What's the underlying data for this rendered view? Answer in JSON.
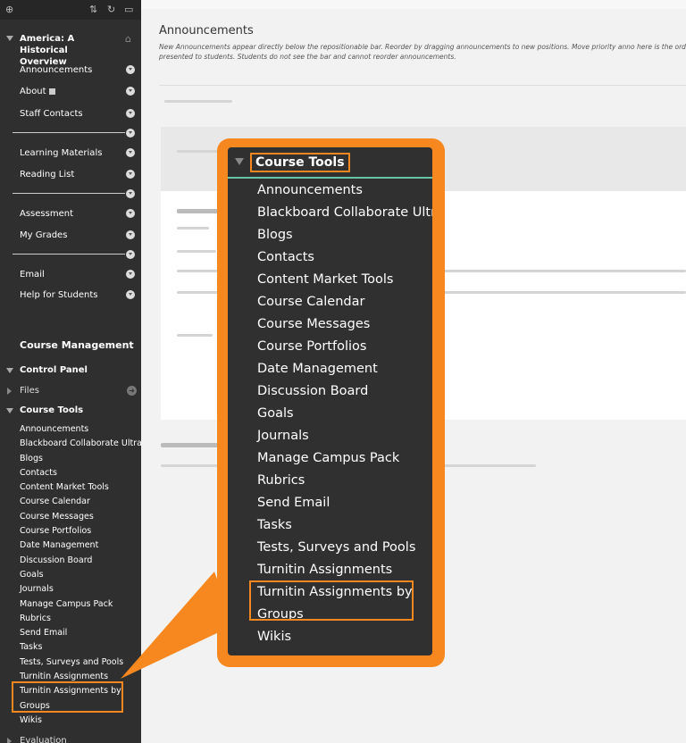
{
  "sidebar": {
    "course_title": "America: A Historical Overview",
    "menu": [
      {
        "label": "Announcements"
      },
      {
        "label": "About"
      },
      {
        "label": "Staff Contacts"
      },
      {
        "label": "Learning Materials"
      },
      {
        "label": "Reading List"
      },
      {
        "label": "Assessment"
      },
      {
        "label": "My Grades"
      },
      {
        "label": "Email"
      },
      {
        "label": "Help for Students"
      }
    ],
    "course_management": "Course Management",
    "control_panel": "Control Panel",
    "files": "Files",
    "course_tools_heading": "Course Tools",
    "evaluation": "Evaluation"
  },
  "course_tools": [
    "Announcements",
    "Blackboard Collaborate Ultra",
    "Blogs",
    "Contacts",
    "Content Market Tools",
    "Course Calendar",
    "Course Messages",
    "Course Portfolios",
    "Date Management",
    "Discussion Board",
    "Goals",
    "Journals",
    "Manage Campus Pack",
    "Rubrics",
    "Send Email",
    "Tasks",
    "Tests, Surveys and Pools",
    "Turnitin Assignments",
    "Turnitin Assignments by Groups",
    "Wikis"
  ],
  "callout": {
    "heading": "Course Tools",
    "highlighted_line1": "Turnitin Assignments by",
    "highlighted_line2": "Groups"
  },
  "main": {
    "title": "Announcements",
    "description": "New Announcements appear directly below the repositionable bar. Reorder by dragging announcements to new positions. Move priority anno here is the order presented to students. Students do not see the bar and cannot reorder announcements."
  },
  "colors": {
    "highlight": "#f7881f",
    "sidebar_bg": "#2f2f2f",
    "callout_rule": "#67c5a8"
  }
}
